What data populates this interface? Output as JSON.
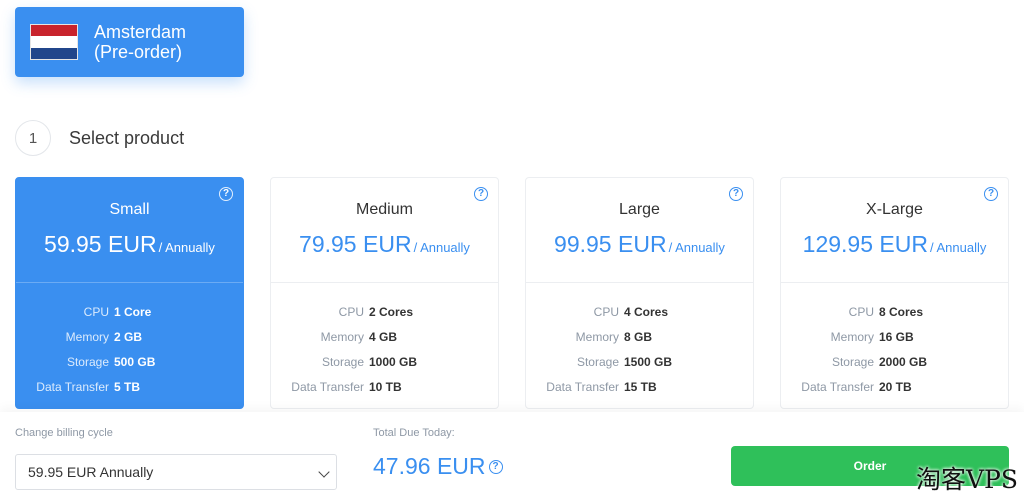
{
  "location": {
    "name": "Amsterdam",
    "sub": "(Pre-order)"
  },
  "step": {
    "number": "1",
    "title": "Select product"
  },
  "plans": [
    {
      "name": "Small",
      "price": "59.95 EUR",
      "cycle": "/ Annually",
      "specs": [
        {
          "k": "CPU",
          "v": "1 Core"
        },
        {
          "k": "Memory",
          "v": "2 GB"
        },
        {
          "k": "Storage",
          "v": "500 GB"
        },
        {
          "k": "Data Transfer",
          "v": "5 TB"
        }
      ]
    },
    {
      "name": "Medium",
      "price": "79.95 EUR",
      "cycle": "/ Annually",
      "specs": [
        {
          "k": "CPU",
          "v": "2 Cores"
        },
        {
          "k": "Memory",
          "v": "4 GB"
        },
        {
          "k": "Storage",
          "v": "1000 GB"
        },
        {
          "k": "Data Transfer",
          "v": "10 TB"
        }
      ]
    },
    {
      "name": "Large",
      "price": "99.95 EUR",
      "cycle": "/ Annually",
      "specs": [
        {
          "k": "CPU",
          "v": "4 Cores"
        },
        {
          "k": "Memory",
          "v": "8 GB"
        },
        {
          "k": "Storage",
          "v": "1500 GB"
        },
        {
          "k": "Data Transfer",
          "v": "15 TB"
        }
      ]
    },
    {
      "name": "X-Large",
      "price": "129.95 EUR",
      "cycle": "/ Annually",
      "specs": [
        {
          "k": "CPU",
          "v": "8 Cores"
        },
        {
          "k": "Memory",
          "v": "16 GB"
        },
        {
          "k": "Storage",
          "v": "2000 GB"
        },
        {
          "k": "Data Transfer",
          "v": "20 TB"
        }
      ]
    }
  ],
  "help_glyph": "?",
  "billing": {
    "label": "Change billing cycle",
    "selected": "59.95 EUR Annually"
  },
  "total": {
    "label": "Total Due Today:",
    "value": "47.96 EUR"
  },
  "order": {
    "label": "Order"
  },
  "watermark": "淘客VPS",
  "colors": {
    "accent": "#3a8ff0",
    "order": "#2fc05a"
  },
  "icons": {
    "flag": "netherlands-flag-icon",
    "help": "question-circle-icon",
    "select": "chevron-down-icon"
  }
}
